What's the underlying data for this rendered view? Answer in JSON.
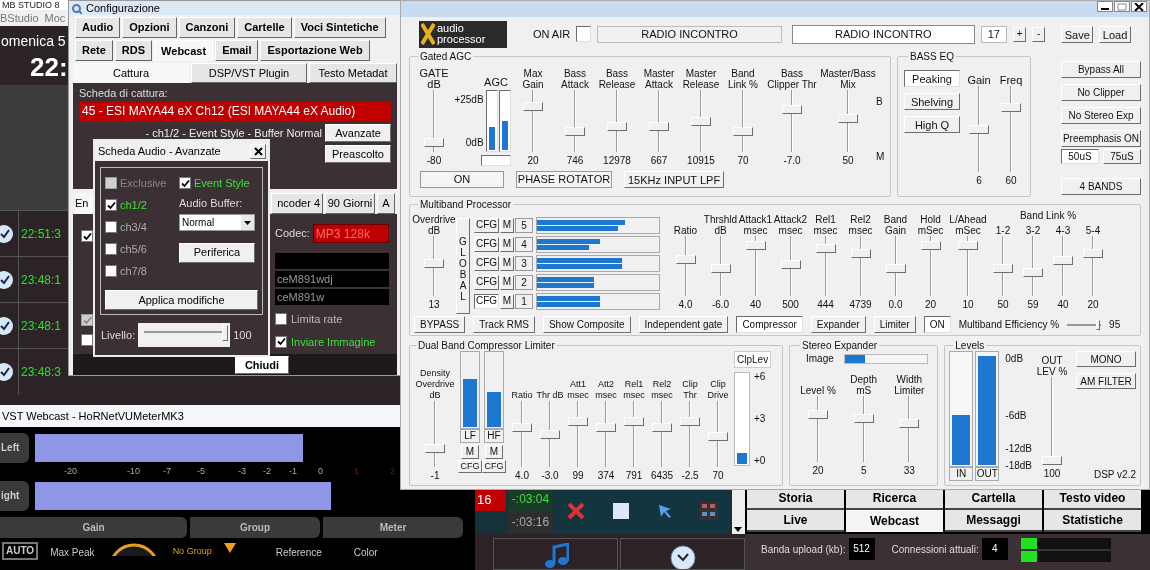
{
  "studio": {
    "title": "MB STUDIO 8",
    "menu": [
      "BStudio",
      "Moc"
    ],
    "date": "omenica 5",
    "clock": "22:",
    "log": [
      {
        "time": "22:51:3"
      },
      {
        "time": "23:48:1"
      },
      {
        "time": "23:48:1"
      },
      {
        "time": "23:48:3"
      }
    ]
  },
  "config": {
    "title": "Configurazione",
    "tab_rows": [
      [
        {
          "label": "Audio",
          "selected": false
        },
        {
          "label": "Opzioni",
          "selected": false
        },
        {
          "label": "Canzoni",
          "selected": false
        },
        {
          "label": "Cartelle",
          "selected": false
        },
        {
          "label": "Voci Sintetiche",
          "selected": false
        }
      ],
      [
        {
          "label": "Rete",
          "selected": false
        },
        {
          "label": "RDS",
          "selected": false
        },
        {
          "label": "Webcast",
          "selected": true
        },
        {
          "label": "Email",
          "selected": false
        },
        {
          "label": "Esportazione Web",
          "selected": false
        }
      ]
    ],
    "subtabs": [
      {
        "label": "Cattura",
        "selected": true
      },
      {
        "label": "DSP/VST Plugin",
        "selected": false
      },
      {
        "label": "Testo Metadat",
        "selected": false
      }
    ],
    "capture_label": "Scheda di cattura:",
    "capture_device": "45 - ESI MAYA44 eX Ch12 (ESI MAYA44 eX Audio)",
    "capture_summary": "- ch1/2 - Event Style - Buffer Normal",
    "buttons": [
      "Avanzate",
      "Preascolto"
    ],
    "encoder_tabs": [
      {
        "label": "En",
        "selected": true
      },
      {
        "label": "ncoder 4",
        "selected": false
      },
      {
        "label": "90 Giorni",
        "selected": false
      },
      {
        "label": "A",
        "selected": false
      }
    ],
    "left_checks": [
      {
        "checked": true,
        "disabled": false
      },
      {
        "checked": true,
        "disabled": true
      },
      {
        "checked": false,
        "disabled": false
      }
    ],
    "codec_label": "Codec:",
    "codec": "MP3 128k",
    "fields": [
      "ceM891wdj",
      "ceM891w"
    ],
    "options": [
      {
        "label": "Limita rate",
        "checked": false
      },
      {
        "label": "Inviare Immagine",
        "checked": true
      }
    ],
    "close_button": "Chiudi"
  },
  "dialog": {
    "title": "Scheda Audio - Avanzate",
    "channels": [
      {
        "label": "Exclusive",
        "checked": false,
        "disabled": true
      },
      {
        "label": "ch1/2",
        "checked": true,
        "disabled": false
      },
      {
        "label": "ch3/4",
        "checked": false,
        "disabled": false
      },
      {
        "label": "ch5/6",
        "checked": false,
        "disabled": false
      },
      {
        "label": "ch7/8",
        "checked": false,
        "disabled": false
      }
    ],
    "event_style": {
      "label": "Event Style",
      "checked": true
    },
    "buffer_label": "Audio Buffer:",
    "buffer": "Normal",
    "device_button": "Periferica",
    "apply_button": "Applica modifiche",
    "volume": {
      "label": "Livello:",
      "level": 0.97,
      "reading": "100"
    }
  },
  "vst": {
    "title": "VST Webcast - HoRNetVUMeterMK3",
    "channels": [
      {
        "label": "Left",
        "level": 0.67
      },
      {
        "label": "ight",
        "level": 0.74
      }
    ],
    "scale": [
      "-20",
      "-10",
      "-7",
      "-5",
      "-3",
      "-2",
      "-1",
      "0",
      "1",
      "2"
    ],
    "tabs": [
      "Gain",
      "Group",
      "Meter"
    ],
    "auto": "AUTO",
    "max_peak": "Max Peak",
    "group": "No Group",
    "reference": "Reference",
    "color_label": "Color"
  },
  "processor": {
    "logo": [
      "audio",
      "processor"
    ],
    "on_air": "ON AIR",
    "station": "RADIO INCONTRO",
    "station_edit": "RADIO INCONTRO",
    "preset": "17",
    "plus": "+",
    "minus": "-",
    "save": "Save",
    "load": "Load",
    "agc": {
      "title": "Gated AGC",
      "gate": {
        "label": "GATE dB",
        "level": 0.1,
        "value": "-80"
      },
      "meter": {
        "label": "AGC",
        "top": "+25dB",
        "bottom": "0dB",
        "bars": [
          {
            "level": 0.4
          },
          {
            "level": 0.5
          }
        ]
      },
      "sliders": [
        {
          "label": "Max Gain",
          "level": 0.78,
          "value": "20"
        },
        {
          "label": "Bass Attack",
          "level": 0.3,
          "value": "746"
        },
        {
          "label": "Bass Release",
          "level": 0.4,
          "value": "12978"
        },
        {
          "label": "Master Attack",
          "level": 0.4,
          "value": "667"
        },
        {
          "label": "Master Release",
          "level": 0.5,
          "value": "10915"
        },
        {
          "label": "Band Link %",
          "level": 0.3,
          "value": "70"
        },
        {
          "label": "Bass Clipper Thr",
          "level": 0.72,
          "value": "-7.0"
        },
        {
          "label": "Master/Bass Mix",
          "level": 0.55,
          "value": "50"
        }
      ],
      "mix_marks": [
        "B",
        "M"
      ],
      "buttons": [
        {
          "label": "ON",
          "kind": "indicator"
        },
        {
          "label": "PHASE ROTATOR",
          "kind": "indicator"
        },
        {
          "label": "15KHz INPUT LPF",
          "kind": "button"
        }
      ]
    },
    "bass_eq": {
      "title": "BASS EQ",
      "modes": [
        {
          "label": "Peaking",
          "selected": true
        },
        {
          "label": "Shelving",
          "selected": false
        },
        {
          "label": "High Q",
          "selected": false
        }
      ],
      "sliders": [
        {
          "label": "Gain",
          "level": 0.5,
          "value": "6"
        },
        {
          "label": "Freq",
          "level": 0.78,
          "value": "60"
        }
      ]
    },
    "side_buttons": [
      "Bypass All",
      "No Clipper",
      "No Stereo Exp",
      "Preemphasis ON"
    ],
    "preemphasis": [
      {
        "label": "50uS",
        "selected": true
      },
      {
        "label": "75uS",
        "selected": false
      }
    ],
    "bands_button": "4 BANDS",
    "multiband": {
      "title": "Multiband Processor",
      "overdrive": {
        "label": "Overdrive dB",
        "level": 0.55,
        "value": "13"
      },
      "global": "GLOBAL",
      "bands": [
        {
          "cfg": "CFG",
          "cfg_selected": false,
          "mute": "M",
          "number": "5",
          "bars": [
            {
              "level": 0.72
            },
            {
              "level": 0.66
            }
          ]
        },
        {
          "cfg": "CFG",
          "cfg_selected": false,
          "mute": "M",
          "number": "4",
          "bars": [
            {
              "level": 0.52
            },
            {
              "level": 0.43
            }
          ]
        },
        {
          "cfg": "CFG",
          "cfg_selected": false,
          "mute": "M",
          "number": "3",
          "bars": [
            {
              "level": 0.7
            },
            {
              "level": 0.7
            }
          ]
        },
        {
          "cfg": "CFG",
          "cfg_selected": false,
          "mute": "M",
          "number": "2",
          "bars": [
            {
              "level": 0.47
            },
            {
              "level": 0.47
            }
          ]
        },
        {
          "cfg": "CFG",
          "cfg_selected": true,
          "mute": "M",
          "number": "1",
          "bars": [
            {
              "level": 0.52
            },
            {
              "level": 0.52
            }
          ]
        }
      ],
      "sliders": [
        {
          "label": "Ratio",
          "level": 0.62,
          "value": "4.0"
        },
        {
          "label": "Thrshld dB",
          "level": 0.45,
          "value": "-6.0"
        },
        {
          "label": "Attack1 msec",
          "level": 0.9,
          "value": "40"
        },
        {
          "label": "Attack2 msec",
          "level": 0.52,
          "value": "500"
        },
        {
          "label": "Rel1 msec",
          "level": 0.85,
          "value": "444"
        },
        {
          "label": "Rel2 msec",
          "level": 0.75,
          "value": "4739"
        },
        {
          "label": "Band Gain",
          "level": 0.45,
          "value": "0.0"
        },
        {
          "label": "Hold mSec",
          "level": 0.9,
          "value": "20"
        },
        {
          "label": "L/Ahead mSec",
          "level": 0.9,
          "value": "10"
        }
      ],
      "link_title": "Band Link %",
      "links": [
        {
          "label": "1-2",
          "level": 0.45,
          "value": "50"
        },
        {
          "label": "3-2",
          "level": 0.38,
          "value": "59"
        },
        {
          "label": "4-3",
          "level": 0.6,
          "value": "40"
        },
        {
          "label": "5-4",
          "level": 0.75,
          "value": "20"
        }
      ],
      "buttons": [
        {
          "label": "BYPASS",
          "selected": false
        },
        {
          "label": "Track RMS",
          "selected": false
        },
        {
          "label": "Show Composite",
          "selected": false
        },
        {
          "label": "Independent gate",
          "selected": false
        },
        {
          "label": "Compressor",
          "selected": true
        },
        {
          "label": "Expander",
          "selected": false
        },
        {
          "label": "Limiter",
          "selected": false
        },
        {
          "label": "ON",
          "selected": true
        }
      ],
      "efficiency": {
        "label": "Multiband Efficiency %",
        "level": 0.95,
        "value": "95"
      }
    },
    "dual": {
      "title": "Dual Band Compressor Limiter",
      "density": {
        "label": "Density Overdrive dB",
        "level": 0.25,
        "value": "-1"
      },
      "bands": [
        {
          "label": "LF",
          "level": 0.65,
          "mute": "M",
          "cfg": "CFG"
        },
        {
          "label": "HF",
          "level": 0.47,
          "mute": "M",
          "cfg": "CFG"
        }
      ],
      "sliders": [
        {
          "label": "Ratio",
          "level": 0.62,
          "value": "4.0"
        },
        {
          "label": "Thr dB",
          "level": 0.5,
          "value": "-3.0"
        },
        {
          "label": "Att1 msec",
          "level": 0.72,
          "value": "99"
        },
        {
          "label": "Att2 msec",
          "level": 0.62,
          "value": "374"
        },
        {
          "label": "Rel1 msec",
          "level": 0.72,
          "value": "791"
        },
        {
          "label": "Rel2 msec",
          "level": 0.62,
          "value": "6435"
        },
        {
          "label": "Clip Thr",
          "level": 0.72,
          "value": "-2.5"
        },
        {
          "label": "Clip Drive",
          "level": 0.45,
          "value": "70"
        }
      ],
      "clip_meter": {
        "label": "ClpLev",
        "level": 0.12,
        "ticks": [
          "+6",
          "+3",
          "+0"
        ]
      }
    },
    "stereo": {
      "title": "Stereo Expander",
      "image": {
        "label": "Image",
        "level": 0.25
      },
      "sliders": [
        {
          "label": "Level %",
          "level": 0.75,
          "value": "20"
        },
        {
          "label": "Depth mS",
          "level": 0.68,
          "value": "5"
        },
        {
          "label": "Width Limiter",
          "level": 0.6,
          "value": "33"
        }
      ]
    },
    "levels": {
      "title": "Levels",
      "meters": [
        {
          "label": "IN",
          "level": 0.45
        },
        {
          "label": "OUT",
          "level": 0.97
        }
      ],
      "scale": [
        "0dB",
        "-6dB",
        "-12dB",
        "-18dB"
      ],
      "out_level": {
        "label": "OUT LEV %",
        "level": 0.0,
        "value": "100"
      },
      "buttons": [
        "MONO",
        "AM FILTER"
      ],
      "version": "DSP v2.2"
    }
  },
  "player": {
    "counter": "16",
    "remaining": "-:03:04",
    "total": "-:03:16",
    "tab_rows": [
      [
        {
          "label": "Storia",
          "selected": false
        },
        {
          "label": "Ricerca",
          "selected": false
        },
        {
          "label": "Cartella",
          "selected": false
        },
        {
          "label": "Testo video",
          "selected": false
        }
      ],
      [
        {
          "label": "Live",
          "selected": false
        },
        {
          "label": "Webcast",
          "selected": true
        },
        {
          "label": "Messaggi",
          "selected": false
        },
        {
          "label": "Statistiche",
          "selected": false
        }
      ]
    ],
    "upload_label": "Banda upload (kb):",
    "upload": "512",
    "connections_label": "Connessioni attuali:",
    "connections": "4",
    "meters": [
      {
        "level": 0.18
      },
      {
        "level": 0.18
      }
    ]
  }
}
